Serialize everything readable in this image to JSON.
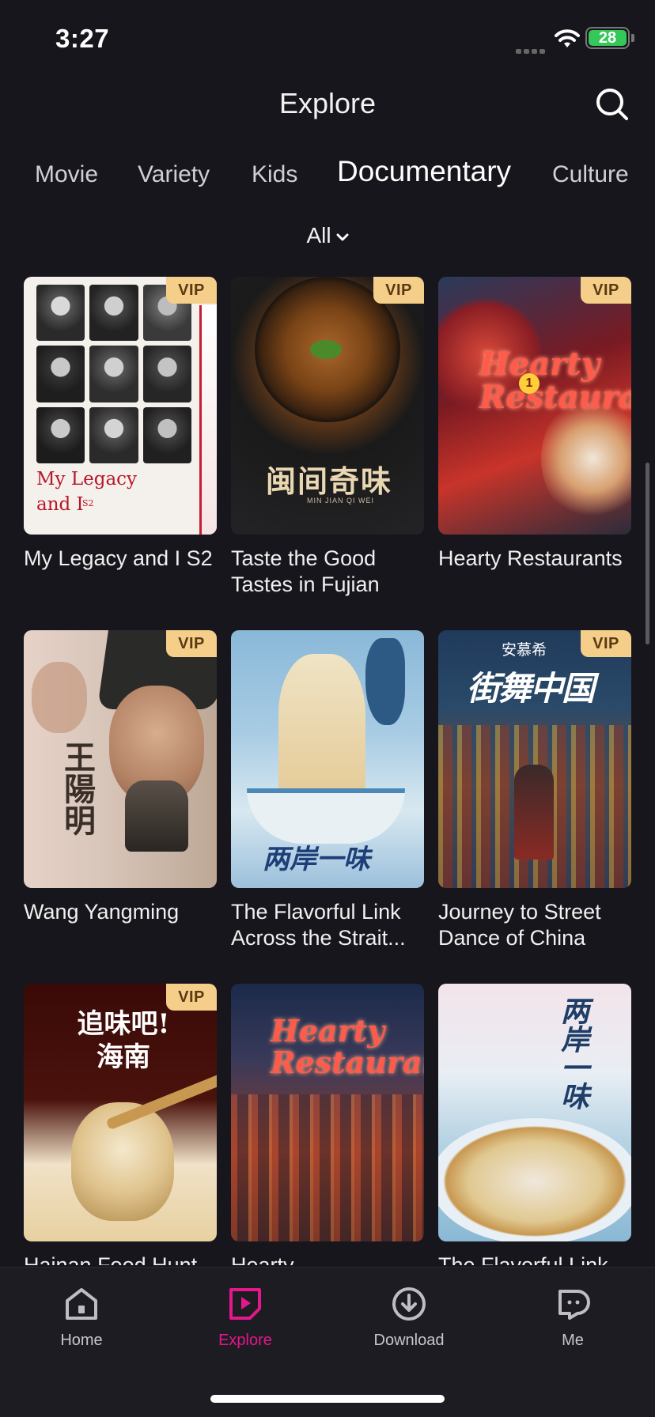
{
  "status": {
    "time": "3:27",
    "battery": "28"
  },
  "header": {
    "title": "Explore"
  },
  "tabs": [
    {
      "label": "Movie",
      "active": false
    },
    {
      "label": "Variety",
      "active": false
    },
    {
      "label": "Kids",
      "active": false
    },
    {
      "label": "Documentary",
      "active": true
    },
    {
      "label": "Culture",
      "active": false
    }
  ],
  "filter": {
    "label": "All"
  },
  "cards": [
    {
      "title": "My Legacy and I S2",
      "vip": "VIP",
      "poster_text": "My Legacy and I",
      "poster_subtext": "S2"
    },
    {
      "title": "Taste the Good Tastes in Fujian",
      "vip": "VIP",
      "poster_text": "闽间奇味",
      "poster_subtext": "MIN JIAN QI WEI"
    },
    {
      "title": "Hearty Restaurants",
      "vip": "VIP",
      "poster_text": "Hearty Restaurant",
      "poster_subtext": "1"
    },
    {
      "title": "Wang Yangming",
      "vip": "VIP",
      "poster_text": "王陽明",
      "poster_subtext": ""
    },
    {
      "title": "The Flavorful Link Across the Strait...",
      "vip": "",
      "poster_text": "两岸一味",
      "poster_subtext": ""
    },
    {
      "title": "Journey to Street Dance of China",
      "vip": "VIP",
      "poster_text": "街舞中国",
      "poster_subtext": "安慕希"
    },
    {
      "title": "Hainan Food Hunt",
      "vip": "VIP",
      "poster_text": "追味吧!海南",
      "poster_subtext": ""
    },
    {
      "title": "Hearty",
      "vip": "",
      "poster_text": "Hearty Restaurant",
      "poster_subtext": ""
    },
    {
      "title": "The Flavorful Link",
      "vip": "",
      "poster_text": "两岸一味",
      "poster_subtext": ""
    }
  ],
  "tabbar": [
    {
      "label": "Home",
      "icon": "home-icon"
    },
    {
      "label": "Explore",
      "icon": "explore-icon"
    },
    {
      "label": "Download",
      "icon": "download-icon"
    },
    {
      "label": "Me",
      "icon": "me-icon"
    }
  ],
  "colors": {
    "accent": "#e4178c",
    "vip_bg": "#f5cf8a",
    "background": "#16161c"
  }
}
